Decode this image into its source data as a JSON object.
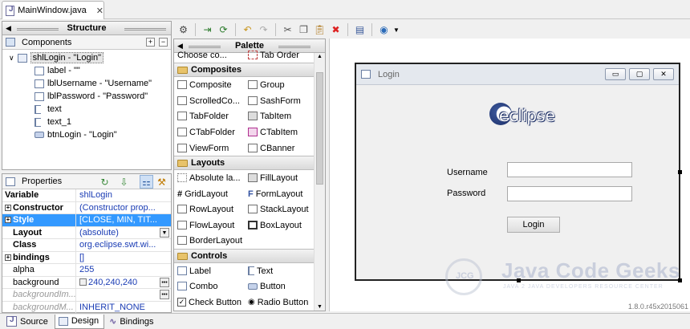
{
  "editor": {
    "tab_title": "MainWindow.java",
    "close": "✕"
  },
  "structure": {
    "title": "Structure",
    "components_title": "Components",
    "tree": [
      {
        "label": "shlLogin - \"Login\""
      },
      {
        "label": "label - \"\""
      },
      {
        "label": "lblUsername - \"Username\""
      },
      {
        "label": "lblPassword - \"Password\""
      },
      {
        "label": "text"
      },
      {
        "label": "text_1"
      },
      {
        "label": "btnLogin - \"Login\""
      }
    ]
  },
  "properties": {
    "title": "Properties",
    "rows": [
      {
        "name": "Variable",
        "value": "shlLogin"
      },
      {
        "name": "Constructor",
        "value": "(Constructor prop..."
      },
      {
        "name": "Style",
        "value": "[CLOSE, MIN, TIT..."
      },
      {
        "name": "Layout",
        "value": "(absolute)"
      },
      {
        "name": "Class",
        "value": "org.eclipse.swt.wi..."
      },
      {
        "name": "bindings",
        "value": "[]"
      },
      {
        "name": "alpha",
        "value": "255"
      },
      {
        "name": "background",
        "value": "240,240,240"
      },
      {
        "name": "backgroundIm...",
        "value": ""
      },
      {
        "name": "backgroundM...",
        "value": "INHERIT_NONE"
      }
    ]
  },
  "palette": {
    "title": "Palette",
    "top_items": [
      "Choose co...",
      "Tab Order"
    ],
    "composites_title": "Composites",
    "composites": [
      "Composite",
      "Group",
      "ScrolledCo...",
      "SashForm",
      "TabFolder",
      "TabItem",
      "CTabFolder",
      "CTabItem",
      "ViewForm",
      "CBanner"
    ],
    "layouts_title": "Layouts",
    "layouts": [
      "Absolute la...",
      "FillLayout",
      "GridLayout",
      "FormLayout",
      "RowLayout",
      "StackLayout",
      "FlowLayout",
      "BoxLayout",
      "BorderLayout"
    ],
    "controls_title": "Controls",
    "controls": [
      "Label",
      "Text",
      "Combo",
      "Button",
      "Check Button",
      "Radio Button"
    ]
  },
  "design": {
    "window_title": "Login",
    "logo_text": "eclipse",
    "username_label": "Username",
    "password_label": "Password",
    "login_button": "Login",
    "min_icon": "▭",
    "max_icon": "▢",
    "close_icon": "✕"
  },
  "watermark": {
    "title": "Java Code Geeks",
    "subtitle": "JAVA 2 JAVA DEVELOPERS RESOURCE CENTER",
    "logo": "JCG"
  },
  "version": "1.8.0.r45x2015061",
  "bottom_tabs": [
    {
      "label": "Source"
    },
    {
      "label": "Design"
    },
    {
      "label": "Bindings"
    }
  ]
}
